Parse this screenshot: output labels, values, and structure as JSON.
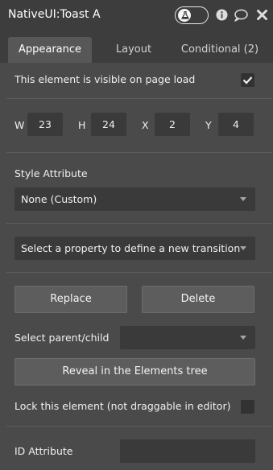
{
  "header": {
    "title": "NativeUI:Toast A",
    "icons": [
      "flask-icon",
      "info-icon",
      "comment-icon",
      "close-icon"
    ]
  },
  "tabs": [
    {
      "label": "Appearance",
      "active": true
    },
    {
      "label": "Layout",
      "active": false
    },
    {
      "label": "Conditional (2)",
      "active": false
    }
  ],
  "appearance": {
    "visible_label": "This element is visible on page load",
    "visible_checked": true,
    "dimensions": {
      "w_label": "W",
      "w_value": "23",
      "h_label": "H",
      "h_value": "24",
      "x_label": "X",
      "x_value": "2",
      "y_label": "Y",
      "y_value": "4"
    },
    "style_attribute_label": "Style Attribute",
    "style_attribute_value": "None (Custom)",
    "transition_placeholder": "Select a property to define a new transition",
    "replace_label": "Replace",
    "delete_label": "Delete",
    "parent_child_label": "Select parent/child",
    "parent_child_value": "",
    "reveal_label": "Reveal in the Elements tree",
    "lock_label": "Lock this element (not draggable in editor)",
    "lock_checked": false,
    "id_attribute_label": "ID Attribute",
    "id_attribute_value": ""
  },
  "colors": {
    "panel_bg": "#4a4a4a",
    "header_bg": "#3d3d3d",
    "field_bg": "#3a3a3a",
    "button_bg": "#5d5d5d"
  }
}
